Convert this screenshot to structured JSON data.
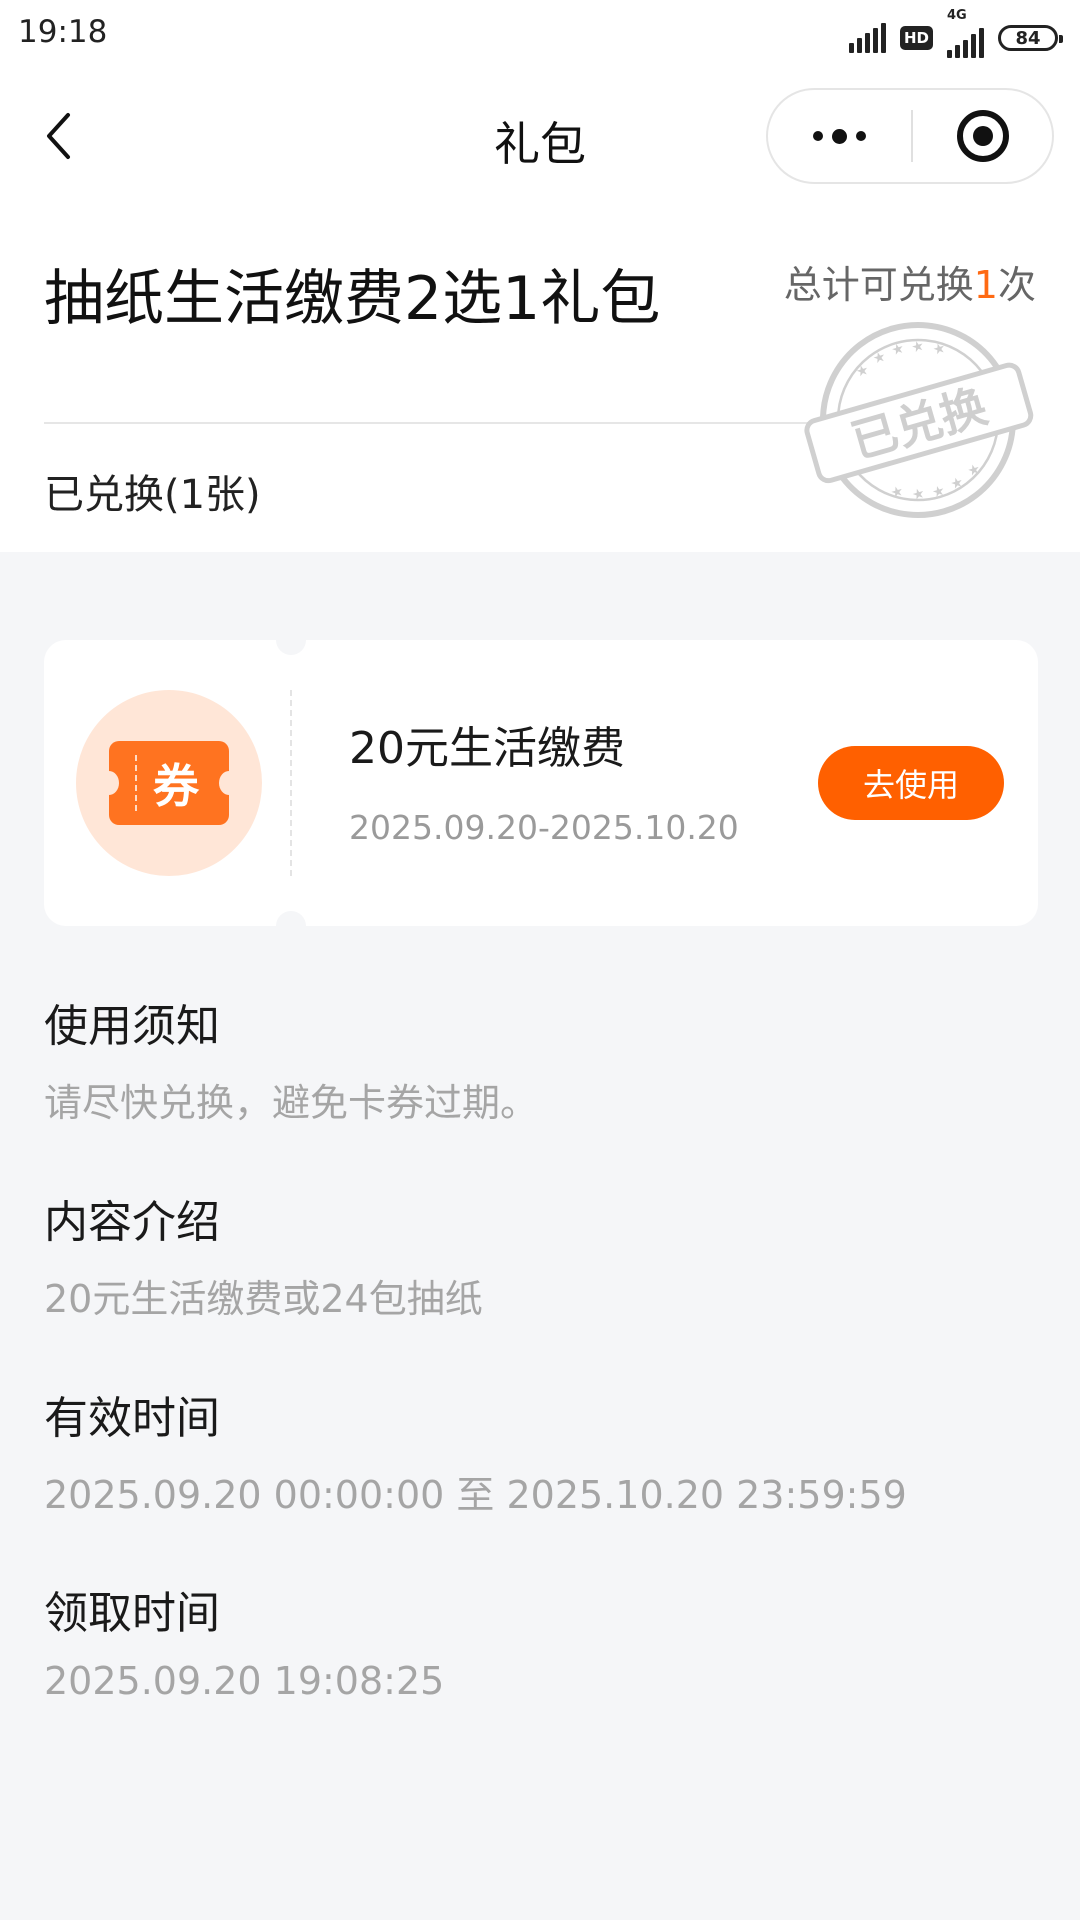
{
  "status_bar": {
    "time": "19:18",
    "network": "4G",
    "hd": "HD",
    "battery": "84"
  },
  "nav": {
    "title": "礼包"
  },
  "gift": {
    "title": "抽纸生活缴费2选1礼包",
    "redeem_prefix": "总计可兑换",
    "redeem_count": "1",
    "redeem_suffix": "次",
    "stamp_text": "已兑换",
    "redeemed_label": "已兑换(1张)"
  },
  "coupon": {
    "icon_char": "券",
    "name": "20元生活缴费",
    "validity": "2025.09.20-2025.10.20",
    "button": "去使用"
  },
  "sections": [
    {
      "title": "使用须知",
      "value": "请尽快兑换，避免卡券过期。"
    },
    {
      "title": "内容介绍",
      "value": "20元生活缴费或24包抽纸"
    },
    {
      "title": "有效时间",
      "value": "2025.09.20 00:00:00 至 2025.10.20 23:59:59"
    },
    {
      "title": "领取时间",
      "value": "2025.09.20 19:08:25"
    }
  ],
  "colors": {
    "accent": "#ff6000",
    "page_bg": "#f5f6f8",
    "card_bg": "#ffffff",
    "secondary_text": "#a5a5a5"
  }
}
